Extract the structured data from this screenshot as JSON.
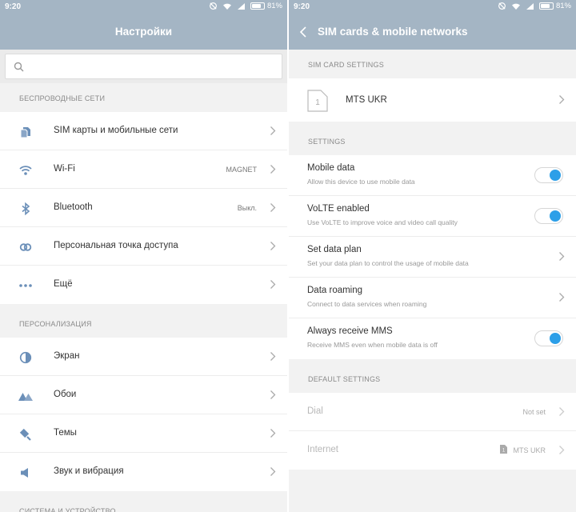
{
  "colors": {
    "header": "#a4b5c4",
    "accent": "#2c9fe8",
    "icon": "#6b8fb8"
  },
  "left": {
    "status": {
      "time": "9:20",
      "battery_pct": "81%",
      "battery_level": 0.81
    },
    "title": "Настройки",
    "search": {
      "placeholder": ""
    },
    "sections": [
      {
        "header": "БЕСПРОВОДНЫЕ СЕТИ",
        "items": [
          {
            "label": "SIM карты и мобильные сети",
            "value": "",
            "icon": "sim-cards-icon"
          },
          {
            "label": "Wi-Fi",
            "value": "MAGNET",
            "icon": "wifi-icon"
          },
          {
            "label": "Bluetooth",
            "value": "Выкл.",
            "icon": "bluetooth-icon"
          },
          {
            "label": "Персональная точка доступа",
            "value": "",
            "icon": "hotspot-icon"
          },
          {
            "label": "Ещё",
            "value": "",
            "icon": "more-icon"
          }
        ]
      },
      {
        "header": "ПЕРСОНАЛИЗАЦИЯ",
        "items": [
          {
            "label": "Экран",
            "value": "",
            "icon": "display-icon"
          },
          {
            "label": "Обои",
            "value": "",
            "icon": "wallpaper-icon"
          },
          {
            "label": "Темы",
            "value": "",
            "icon": "themes-icon"
          },
          {
            "label": "Звук и вибрация",
            "value": "",
            "icon": "sound-icon"
          }
        ]
      },
      {
        "header": "СИСТЕМА И УСТРОЙСТВО"
      }
    ]
  },
  "right": {
    "status": {
      "time": "9:20",
      "battery_pct": "81%",
      "battery_level": 0.81
    },
    "title": "SIM cards & mobile networks",
    "sim_section": "SIM CARD SETTINGS",
    "sim": {
      "slot": "1",
      "name": "MTS UKR"
    },
    "settings_section": "SETTINGS",
    "settings": [
      {
        "label": "Mobile data",
        "sub": "Allow this device to use mobile data",
        "type": "toggle",
        "on": true
      },
      {
        "label": "VoLTE enabled",
        "sub": "Use VoLTE to improve voice and video call quality",
        "type": "toggle",
        "on": true
      },
      {
        "label": "Set data plan",
        "sub": "Set your data plan to control the usage of mobile data",
        "type": "chevron"
      },
      {
        "label": "Data roaming",
        "sub": "Connect to data services when roaming",
        "type": "chevron"
      },
      {
        "label": "Always receive MMS",
        "sub": "Receive MMS even when mobile data is off",
        "type": "toggle",
        "on": true
      }
    ],
    "default_section": "DEFAULT SETTINGS",
    "defaults": [
      {
        "label": "Dial",
        "value": "Not set"
      },
      {
        "label": "Internet",
        "value": "MTS UKR",
        "sim_slot": "1"
      }
    ]
  }
}
